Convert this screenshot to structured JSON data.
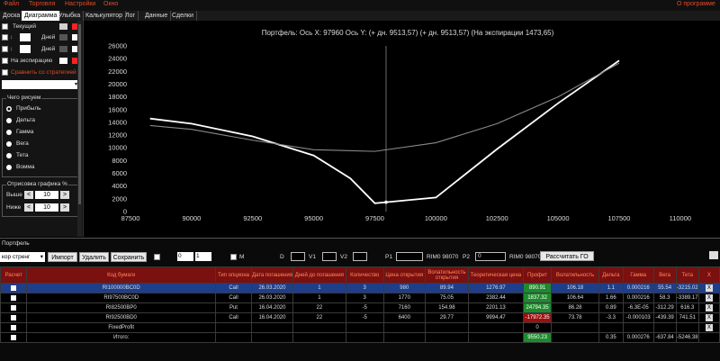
{
  "menu": {
    "items": [
      "Файл",
      "Торговля",
      "Настройки",
      "Окно"
    ],
    "about": "О программе"
  },
  "tabs": [
    "Доска",
    "Диаграмма",
    "Улыбка",
    "Калькулятор",
    "Лог",
    "Данные",
    "Сделки"
  ],
  "sidebar": {
    "lines": [
      {
        "label": "Текущий",
        "days": "",
        "checked": false
      },
      {
        "label": "",
        "days": "Дней",
        "checked": true
      },
      {
        "label": "",
        "days": "Дней",
        "checked": true
      },
      {
        "label": "На экспирацию",
        "days": "",
        "checked": true
      }
    ],
    "swatch_colors": [
      "#d0d0d0",
      "#ff2020",
      "#555555",
      "#ffffff",
      "#555555",
      "#ffffff",
      "#ffffff",
      "#ff2020"
    ],
    "compare_link": "Сравнить со стратегией",
    "draw_group_title": "Чего рисуем",
    "radios": [
      "Прибыль",
      "Дельта",
      "Гамма",
      "Вега",
      "Тета",
      "Вомма"
    ],
    "render_group_title": "Отрисовка графика %",
    "above_label": "Выше",
    "above_value": "10",
    "below_label": "Ниже",
    "below_value": "10",
    "dec": "<",
    "inc": ">"
  },
  "chart_data": {
    "type": "line",
    "title": "Портфель: Ось X: 97960 Ось Y:   (+ дн. 9513,57)   (+ дн. 9513,57)   (На экспирации 1473,65)",
    "xlim": [
      87500,
      111000
    ],
    "ylim": [
      0,
      26000
    ],
    "x_ticks": [
      87500,
      90000,
      92500,
      95000,
      97500,
      100000,
      102500,
      105000,
      107500,
      110000
    ],
    "y_ticks": [
      0,
      2000,
      4000,
      6000,
      8000,
      10000,
      12000,
      14000,
      16000,
      18000,
      20000,
      22000,
      24000,
      26000
    ],
    "cursor_x": 97960,
    "series": [
      {
        "color": "#ffffff",
        "points": [
          [
            88300,
            14600
          ],
          [
            90000,
            13800
          ],
          [
            92500,
            11800
          ],
          [
            95000,
            8800
          ],
          [
            96500,
            5200
          ],
          [
            97500,
            1300
          ],
          [
            97960,
            1470
          ],
          [
            100000,
            2200
          ],
          [
            102500,
            9800
          ],
          [
            105000,
            17000
          ],
          [
            107500,
            23700
          ]
        ]
      },
      {
        "color": "#8a8a8a",
        "points": [
          [
            88300,
            13500
          ],
          [
            90000,
            12900
          ],
          [
            92500,
            11200
          ],
          [
            95000,
            9700
          ],
          [
            97500,
            9450
          ],
          [
            100000,
            10800
          ],
          [
            102500,
            13800
          ],
          [
            105000,
            18000
          ],
          [
            107500,
            23300
          ]
        ]
      }
    ]
  },
  "portfolio": {
    "label": "Портфель",
    "select_value": "кор стренг",
    "import": "Импорт",
    "delete": "Удалить",
    "save": "Сохранить",
    "spin1": "0",
    "spin2": "1",
    "m_label": "М",
    "d_label": "D",
    "v1_label": "V1",
    "v2_label": "V2",
    "p1_label": "P1",
    "p1_ticker": "RIM0 98070",
    "p2_label": "P2",
    "p2_value": "0",
    "p2_ticker": "RIM0 98070",
    "calc_go": "Рассчитать ГО"
  },
  "table": {
    "headers": [
      "Расчет",
      "Код бумаги",
      "Тип опциона",
      "Дата погашения",
      "Дней до погашения",
      "Количество",
      "Цена открытия",
      "Волатильность открытия",
      "Теоретическая цена",
      "Профит",
      "Волатильность",
      "Дельта",
      "Гамма",
      "Вега",
      "Тета",
      "X"
    ],
    "rows": [
      {
        "code": "RI100000BC0D",
        "type": "Call",
        "date": "26.03.2020",
        "days": "1",
        "qty": "3",
        "price": "980",
        "vol_open": "89.94",
        "theo": "1276.97",
        "profit": "890.91",
        "vol": "106.18",
        "delta": "1.1",
        "gamma": "0.000216",
        "vega": "55.54",
        "theta": "-3215.02",
        "x": "X",
        "sign": "pos",
        "checked": true
      },
      {
        "code": "RI97500BC0D",
        "type": "Call",
        "date": "26.03.2020",
        "days": "1",
        "qty": "3",
        "price": "1770",
        "vol_open": "75.05",
        "theo": "2382.44",
        "profit": "1837.32",
        "vol": "106.64",
        "delta": "1.66",
        "gamma": "0.000216",
        "vega": "58.3",
        "theta": "-3389.17",
        "x": "X",
        "sign": "pos",
        "checked": true
      },
      {
        "code": "RI82500BP0",
        "type": "Put",
        "date": "16.04.2020",
        "days": "22",
        "qty": "-5",
        "price": "7160",
        "vol_open": "154.98",
        "theo": "2201.13",
        "profit": "24794.35",
        "vol": "86.28",
        "delta": "0.89",
        "gamma": "-6.3E-05",
        "vega": "-312.29",
        "theta": "616.3",
        "x": "X",
        "sign": "pos",
        "checked": true
      },
      {
        "code": "RI92500BD0",
        "type": "Call",
        "date": "16.04.2020",
        "days": "22",
        "qty": "-5",
        "price": "6400",
        "vol_open": "29.77",
        "theo": "9994.47",
        "profit": "-17972.35",
        "vol": "73.78",
        "delta": "-3.3",
        "gamma": "-0.000103",
        "vega": "-439.39",
        "theta": "741.51",
        "x": "X",
        "sign": "neg",
        "checked": true
      },
      {
        "code": "FixedProfit",
        "type": "",
        "date": "",
        "days": "",
        "qty": "",
        "price": "",
        "vol_open": "",
        "theo": "",
        "profit": "0",
        "vol": "",
        "delta": "",
        "gamma": "",
        "vega": "",
        "theta": "",
        "x": "X",
        "sign": "",
        "checked": true
      },
      {
        "code": "Итого:",
        "type": "",
        "date": "",
        "days": "",
        "qty": "",
        "price": "",
        "vol_open": "",
        "theo": "",
        "profit": "9550.23",
        "vol": "",
        "delta": "0.35",
        "gamma": "0.000276",
        "vega": "-637.84",
        "theta": "-5246.38",
        "x": "",
        "sign": "pos",
        "checked": true
      }
    ]
  }
}
